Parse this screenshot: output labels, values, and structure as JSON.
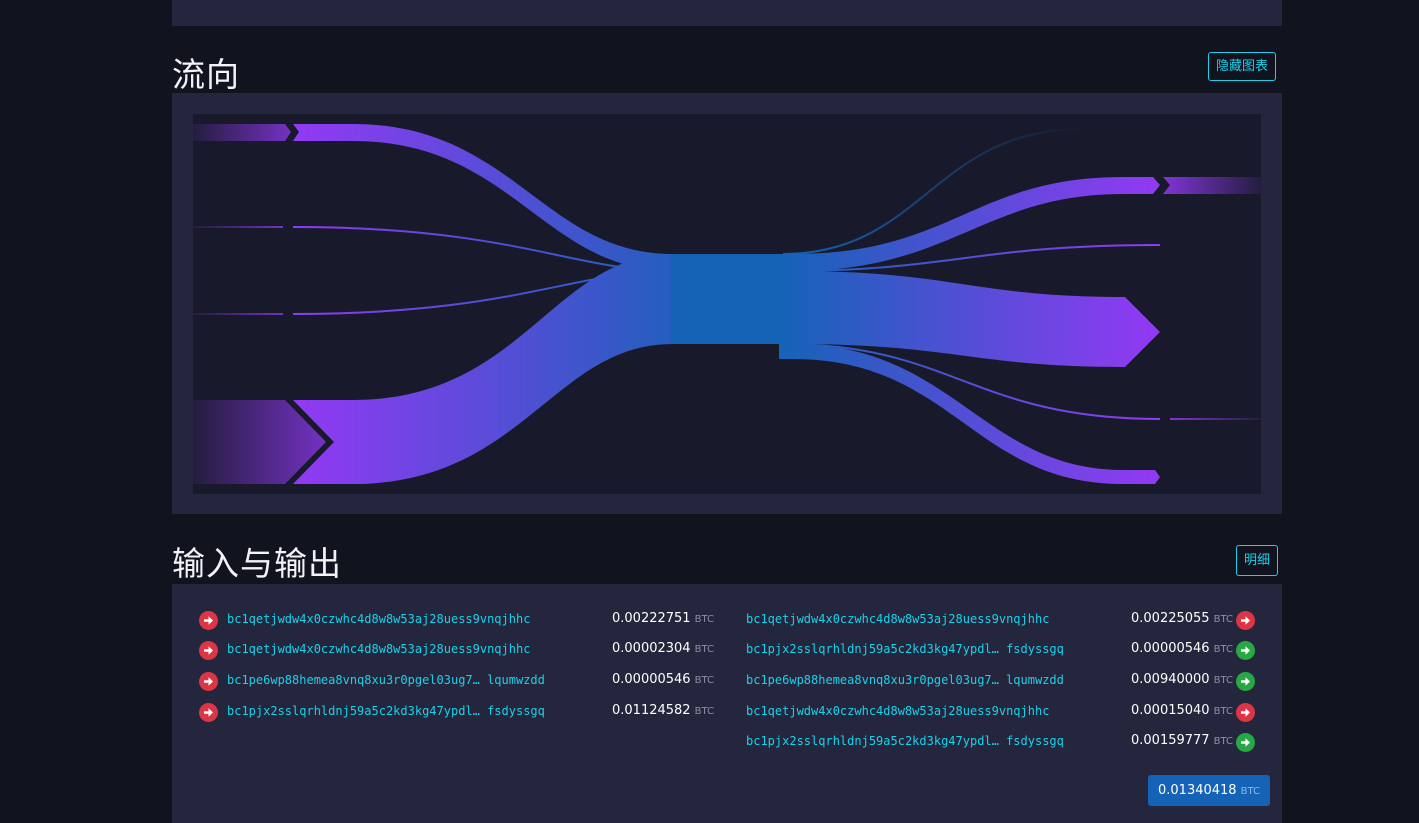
{
  "flow": {
    "title": "流向",
    "hide_chart_label": "隐藏图表"
  },
  "io": {
    "title": "输入与输出",
    "detail_label": "明细",
    "inputs": [
      {
        "address": "bc1qetjwdw4x0czwhc4d8w8w53aj28uess9vnqjhhc",
        "amount": "0.00222751",
        "unit": "BTC",
        "status": "spent"
      },
      {
        "address": "bc1qetjwdw4x0czwhc4d8w8w53aj28uess9vnqjhhc",
        "amount": "0.00002304",
        "unit": "BTC",
        "status": "spent"
      },
      {
        "address": "bc1pe6wp88hemea8vnq8xu3r0pgel03ug7… lqumwzdd",
        "amount": "0.00000546",
        "unit": "BTC",
        "status": "spent"
      },
      {
        "address": "bc1pjx2sslqrhldnj59a5c2kd3kg47ypdl… fsdyssgq",
        "amount": "0.01124582",
        "unit": "BTC",
        "status": "spent"
      }
    ],
    "outputs": [
      {
        "address": "bc1qetjwdw4x0czwhc4d8w8w53aj28uess9vnqjhhc",
        "amount": "0.00225055",
        "unit": "BTC",
        "status": "spent"
      },
      {
        "address": "bc1pjx2sslqrhldnj59a5c2kd3kg47ypdl… fsdyssgq",
        "amount": "0.00000546",
        "unit": "BTC",
        "status": "unspent"
      },
      {
        "address": "bc1pe6wp88hemea8vnq8xu3r0pgel03ug7… lqumwzdd",
        "amount": "0.00940000",
        "unit": "BTC",
        "status": "unspent"
      },
      {
        "address": "bc1qetjwdw4x0czwhc4d8w8w53aj28uess9vnqjhhc",
        "amount": "0.00015040",
        "unit": "BTC",
        "status": "spent"
      },
      {
        "address": "bc1pjx2sslqrhldnj59a5c2kd3kg47ypdl… fsdyssgq",
        "amount": "0.00159777",
        "unit": "BTC",
        "status": "unspent"
      }
    ],
    "total": {
      "amount": "0.01340418",
      "unit": "BTC"
    }
  },
  "colors": {
    "spent": "#dc3545",
    "unspent": "#28a745",
    "accent": "#1bd1ea",
    "flow_purple": "#9339f4",
    "flow_blue": "#1563b7"
  },
  "icons": {
    "spent": "arrow-right-circle-icon",
    "unspent": "arrow-right-circle-icon"
  }
}
